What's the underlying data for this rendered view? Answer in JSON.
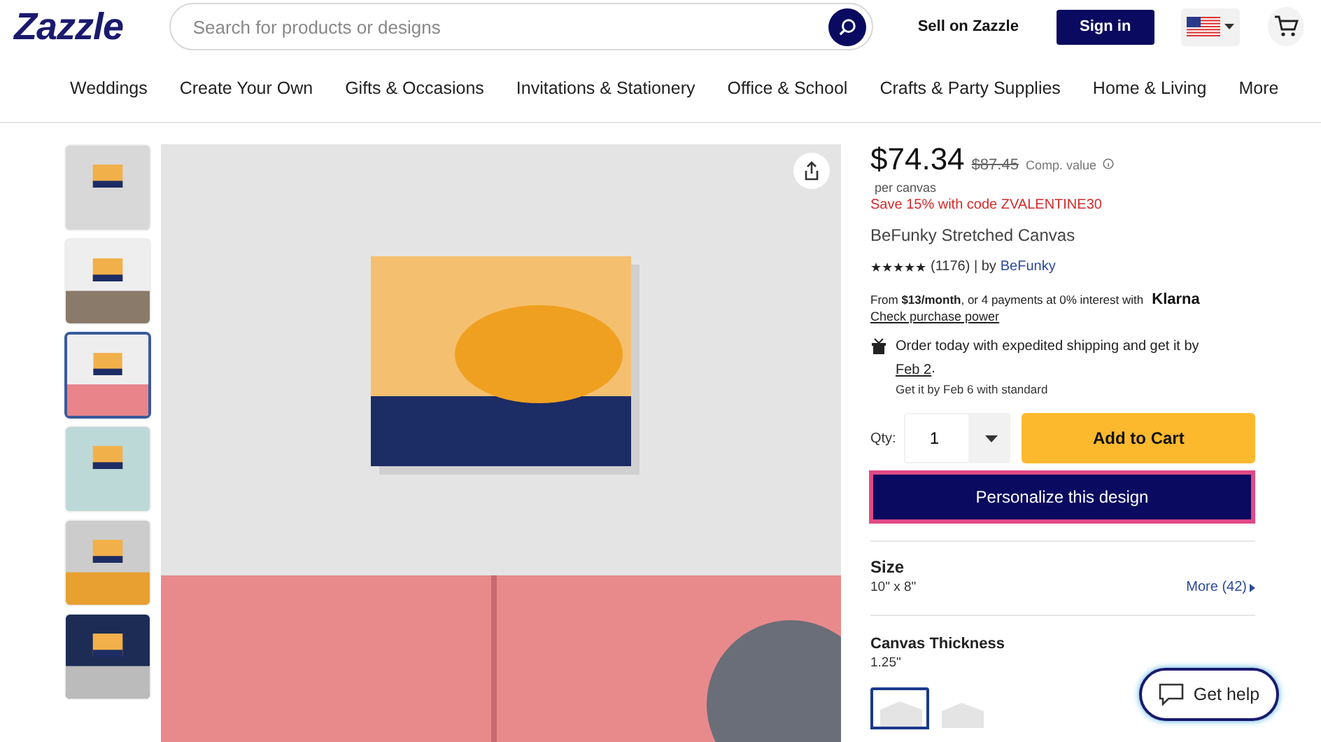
{
  "header": {
    "logo": "Zazzle",
    "search": {
      "placeholder": "Search for products or designs"
    },
    "sell_link": "Sell on Zazzle",
    "sign_in": "Sign in"
  },
  "nav": [
    "Weddings",
    "Create Your Own",
    "Gifts & Occasions",
    "Invitations & Stationery",
    "Office & School",
    "Crafts & Party Supplies",
    "Home & Living",
    "More"
  ],
  "thumbnails": [
    {
      "selected": false
    },
    {
      "selected": false
    },
    {
      "selected": true
    },
    {
      "selected": false
    },
    {
      "selected": false
    },
    {
      "selected": false
    }
  ],
  "product": {
    "price": "$74.34",
    "comp_price": "$87.45",
    "comp_label": "Comp. value",
    "unit": "per canvas",
    "promo": "Save 15% with code ZVALENTINE30",
    "title": "BeFunky Stretched Canvas",
    "stars": 5,
    "reviews": "(1176) | by",
    "seller": "BeFunky",
    "financing": "From **$13/month**, or 4 payments at 0% interest with",
    "klarna": "Klarna",
    "check_power": "Check purchase power",
    "shipping": "Order today with expedited shipping and get it by",
    "ship_date": "Feb 2",
    "ship_date_end": ".",
    "ship_standard": "Get it by Feb 6 with standard",
    "qty_label": "Qty:",
    "qty": "1",
    "add_to_cart": "Add to Cart",
    "personalize": "Personalize this design",
    "size_label": "Size",
    "size_value": "10\" x 8\"",
    "size_more": "More (42)",
    "thickness_label": "Canvas Thickness",
    "thickness_value": "1.25\"",
    "thickness_options": [
      {
        "selected": true
      },
      {
        "selected": false
      }
    ]
  },
  "help": "Get help"
}
